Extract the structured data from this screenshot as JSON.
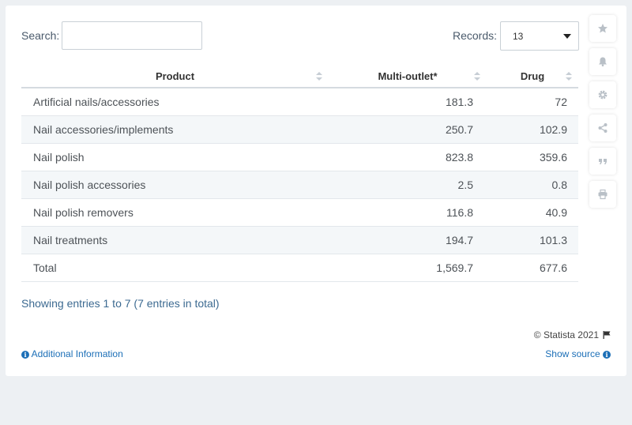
{
  "search": {
    "label": "Search:",
    "value": "",
    "placeholder": ""
  },
  "records": {
    "label": "Records:",
    "value": "13"
  },
  "table": {
    "headers": {
      "product": "Product",
      "multi_outlet": "Multi-outlet*",
      "drug": "Drug"
    },
    "rows": [
      {
        "product": "Artificial nails/accessories",
        "multi_outlet": "181.3",
        "drug": "72"
      },
      {
        "product": "Nail accessories/implements",
        "multi_outlet": "250.7",
        "drug": "102.9"
      },
      {
        "product": "Nail polish",
        "multi_outlet": "823.8",
        "drug": "359.6"
      },
      {
        "product": "Nail polish accessories",
        "multi_outlet": "2.5",
        "drug": "0.8"
      },
      {
        "product": "Nail polish removers",
        "multi_outlet": "116.8",
        "drug": "40.9"
      },
      {
        "product": "Nail treatments",
        "multi_outlet": "194.7",
        "drug": "101.3"
      },
      {
        "product": "Total",
        "multi_outlet": "1,569.7",
        "drug": "677.6"
      }
    ]
  },
  "footer": {
    "entries": "Showing entries 1 to 7 (7 entries in total)",
    "copyright": "© Statista 2021",
    "additional_info": "Additional Information",
    "show_source": "Show source"
  },
  "sidebar": {
    "icons": [
      "star-icon",
      "bell-icon",
      "gear-icon",
      "share-icon",
      "quote-icon",
      "print-icon"
    ]
  },
  "colors": {
    "link": "#1c6fb7",
    "entries_text": "#3c6a91",
    "icon_gray": "#b9c0c7",
    "stripe": "#f4f7f9",
    "background": "#edf0f3"
  }
}
